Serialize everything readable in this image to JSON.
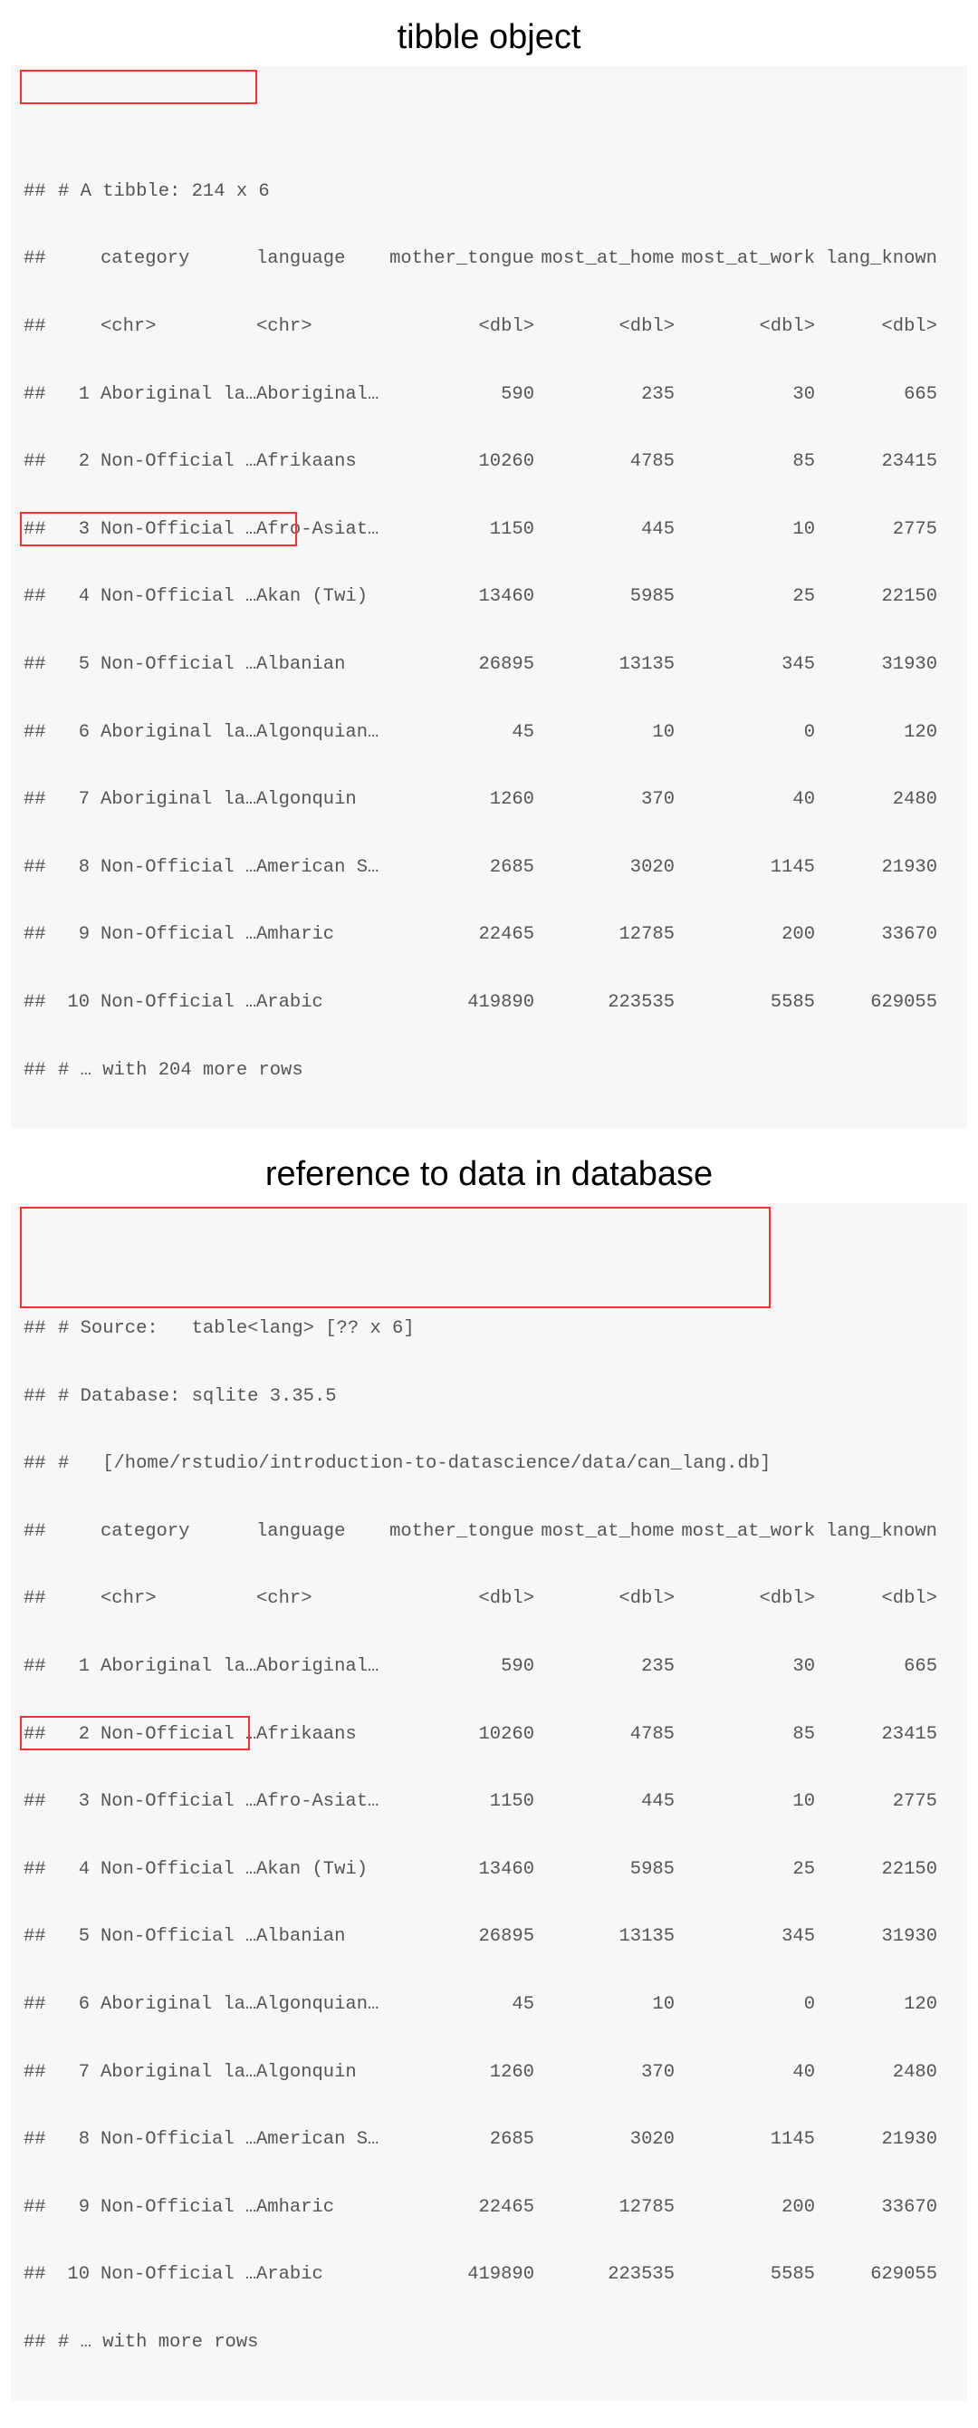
{
  "titles": {
    "top": "tibble object",
    "bottom": "reference to data in database"
  },
  "prefix": "##",
  "tibble_header": "# A tibble: 214 x 6",
  "tibble_footer": "# … with 204 more rows",
  "db_header": {
    "source": "# Source:   table<lang> [?? x 6]",
    "database": "# Database: sqlite 3.35.5",
    "path": "#   [/home/rstudio/introduction-to-datascience/data/can_lang.db]"
  },
  "db_footer": "# … with more rows",
  "columns": {
    "names": [
      "category",
      "language",
      "mother_tongue",
      "most_at_home",
      "most_at_work",
      "lang_known"
    ],
    "types": [
      "<chr>",
      "<chr>",
      "<dbl>",
      "<dbl>",
      "<dbl>",
      "<dbl>"
    ]
  },
  "rows": [
    {
      "idx": "1",
      "category": "Aboriginal la…",
      "language": "Aboriginal…",
      "mother_tongue": "590",
      "most_at_home": "235",
      "most_at_work": "30",
      "lang_known": "665"
    },
    {
      "idx": "2",
      "category": "Non-Official …",
      "language": "Afrikaans",
      "mother_tongue": "10260",
      "most_at_home": "4785",
      "most_at_work": "85",
      "lang_known": "23415"
    },
    {
      "idx": "3",
      "category": "Non-Official …",
      "language": "Afro-Asiat…",
      "mother_tongue": "1150",
      "most_at_home": "445",
      "most_at_work": "10",
      "lang_known": "2775"
    },
    {
      "idx": "4",
      "category": "Non-Official …",
      "language": "Akan (Twi)",
      "mother_tongue": "13460",
      "most_at_home": "5985",
      "most_at_work": "25",
      "lang_known": "22150"
    },
    {
      "idx": "5",
      "category": "Non-Official …",
      "language": "Albanian",
      "mother_tongue": "26895",
      "most_at_home": "13135",
      "most_at_work": "345",
      "lang_known": "31930"
    },
    {
      "idx": "6",
      "category": "Aboriginal la…",
      "language": "Algonquian…",
      "mother_tongue": "45",
      "most_at_home": "10",
      "most_at_work": "0",
      "lang_known": "120"
    },
    {
      "idx": "7",
      "category": "Aboriginal la…",
      "language": "Algonquin",
      "mother_tongue": "1260",
      "most_at_home": "370",
      "most_at_work": "40",
      "lang_known": "2480"
    },
    {
      "idx": "8",
      "category": "Non-Official …",
      "language": "American S…",
      "mother_tongue": "2685",
      "most_at_home": "3020",
      "most_at_work": "1145",
      "lang_known": "21930"
    },
    {
      "idx": "9",
      "category": "Non-Official …",
      "language": "Amharic",
      "mother_tongue": "22465",
      "most_at_home": "12785",
      "most_at_work": "200",
      "lang_known": "33670"
    },
    {
      "idx": "10",
      "category": "Non-Official …",
      "language": "Arabic",
      "mother_tongue": "419890",
      "most_at_home": "223535",
      "most_at_work": "5585",
      "lang_known": "629055"
    }
  ]
}
